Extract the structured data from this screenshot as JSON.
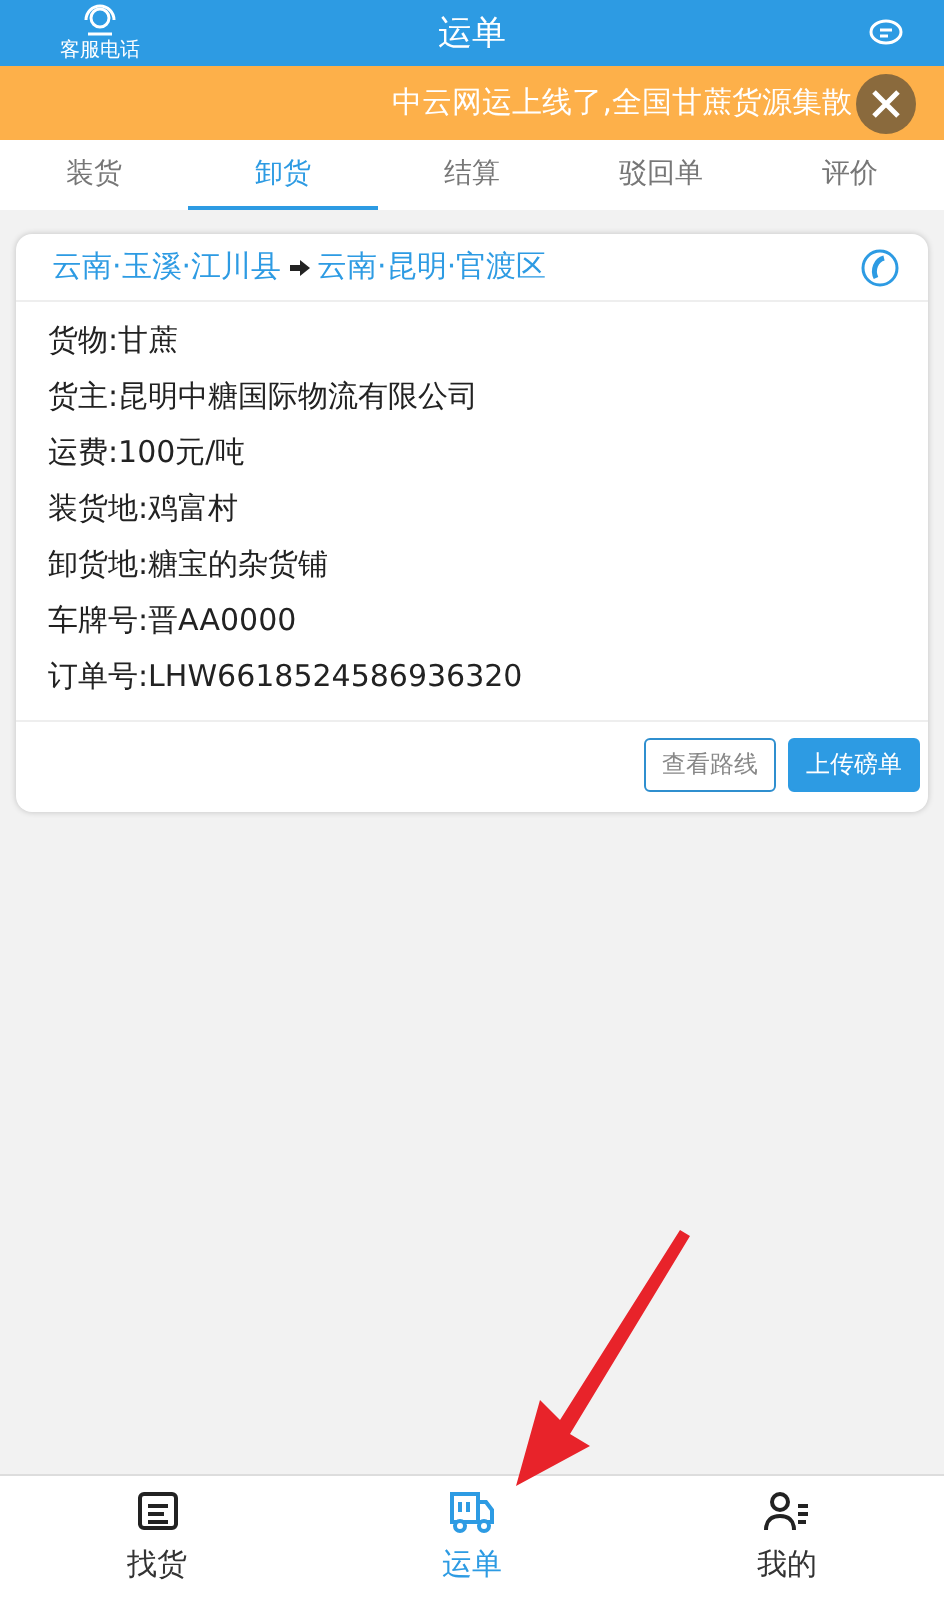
{
  "header": {
    "left_label": "客服电话",
    "title": "运单"
  },
  "banner": {
    "text": "中云网运上线了,全国甘蔗货源集散"
  },
  "tabs": [
    {
      "label": "装货",
      "selected": false
    },
    {
      "label": "卸货",
      "selected": true
    },
    {
      "label": "结算",
      "selected": false
    },
    {
      "label": "驳回单",
      "selected": false
    },
    {
      "label": "评价",
      "selected": false
    }
  ],
  "order": {
    "origin": "云南·玉溪·江川县",
    "destination": "云南·昆明·官渡区",
    "fields": [
      "货物:甘蔗",
      "货主:昆明中糖国际物流有限公司",
      "运费:100元/吨",
      "装货地:鸡富村",
      "卸货地:糖宝的杂货铺",
      "车牌号:晋AA0000",
      "订单号:LHW6618524586936320"
    ],
    "buttons": [
      {
        "label": "查看路线",
        "kind": "outline"
      },
      {
        "label": "上传磅单",
        "kind": "filled"
      }
    ]
  },
  "bottom_nav": [
    {
      "label": "找货",
      "kind": "list",
      "selected": false
    },
    {
      "label": "运单",
      "kind": "truck",
      "selected": true
    },
    {
      "label": "我的",
      "kind": "person",
      "selected": false
    }
  ]
}
